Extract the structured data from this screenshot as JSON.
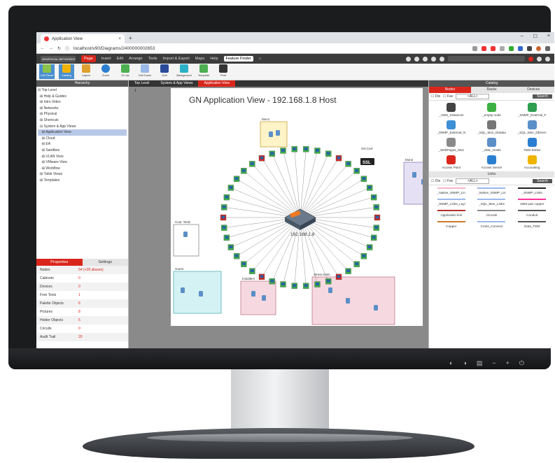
{
  "browser": {
    "tab_title": "Application View",
    "tab_close": "×",
    "new_tab": "+",
    "url": "localhost/v90/Diagrams/2400000002653",
    "win_min": "–",
    "win_max": "☐",
    "win_close": "×"
  },
  "app": {
    "logo_text": "GRAPHICAL NETWORKS",
    "menu": [
      "Page",
      "Insert",
      "Edit",
      "Arrange",
      "Tools",
      "Import & Export",
      "Maps",
      "Help"
    ],
    "feature_finder": "Feature Finder",
    "ribbon": [
      "Left Panel",
      "Catalog",
      "Layers",
      "Zoom",
      "Go Up",
      "Drill Down",
      "Grid",
      "Background",
      "Template",
      "Print"
    ]
  },
  "hierarchy": {
    "header": "Hierarchy",
    "items": [
      "Top Level",
      "Help & Guides",
      "Intro Video",
      "Networks",
      "Physical",
      "Shortcuts",
      "System & App Views",
      "Application View",
      "Cloud",
      "EA",
      "Sandbox",
      "VLAN View",
      "VMware View",
      "Workflow",
      "Table Views",
      "Templates"
    ]
  },
  "properties": {
    "tabs": [
      "Properties",
      "Settings"
    ],
    "rows": [
      {
        "label": "Nodes",
        "value": "54 (+28 aliases)"
      },
      {
        "label": "Cabinets",
        "value": "0"
      },
      {
        "label": "Devices",
        "value": "0"
      },
      {
        "label": "Free Texts",
        "value": "1"
      },
      {
        "label": "Palette Objects",
        "value": "6"
      },
      {
        "label": "Pictures",
        "value": "8"
      },
      {
        "label": "Holder Objects",
        "value": "5"
      },
      {
        "label": "Circuits",
        "value": "0"
      },
      {
        "label": "Audit Trail",
        "value": "20"
      }
    ]
  },
  "breadcrumbs": [
    "Top Level",
    "System & App Views",
    "Application View"
  ],
  "diagram": {
    "page_number": "1",
    "title": "GN Application View - 192.168.1.8 Host",
    "host_label": "192.168.1.8",
    "groups": [
      {
        "label": "Mon1"
      },
      {
        "label": "GN Cert"
      },
      {
        "label": "Mon2"
      },
      {
        "label": "Cust. Tests"
      },
      {
        "label": "Guest"
      },
      {
        "label": "Installers"
      },
      {
        "label": "Stress tests"
      }
    ],
    "ssl_label": "SSL"
  },
  "catalog": {
    "header": "Catalog",
    "tabs": [
      "Nodes",
      "Racks",
      "Devices"
    ],
    "filter_dis": "Dis",
    "filter_fav": "Fav",
    "filter_all": "<ALL>",
    "search": "Search",
    "nodes": [
      {
        "label": "_AWS_Instances",
        "color": "#444"
      },
      {
        "label": "_empty node",
        "color": "#3cb043"
      },
      {
        "label": "_SNMP_External_F",
        "color": "#2e9e4f"
      },
      {
        "label": "_SNMP_External_N",
        "color": "#3d8fd6"
      },
      {
        "label": "_SQL_Mon_Databa",
        "color": "#777"
      },
      {
        "label": "_SQL_Mon_DbServ",
        "color": "#5b8fc7"
      },
      {
        "label": "_WebPages_Mon",
        "color": "#8a8a8a"
      },
      {
        "label": "_XML_Hosts",
        "color": "#5b8fc7"
      },
      {
        "label": "7500 Series",
        "color": "#2b7fd0"
      },
      {
        "label": "Access Point",
        "color": "#d9261c"
      },
      {
        "label": "Access Server",
        "color": "#2b7fd0"
      },
      {
        "label": "Accounting",
        "color": "#f0b400"
      }
    ],
    "links_header": "Links",
    "links": [
      {
        "label": "_Native_SNMP_Lin",
        "color": "#f4b6c6"
      },
      {
        "label": "_Native_SNMP_Lin",
        "color": "#9ab8e8"
      },
      {
        "label": "_SNMP_Links",
        "color": "#222222"
      },
      {
        "label": "_SNMP_Links_Layr",
        "color": "#9ab8e8"
      },
      {
        "label": "_SQL_Mon_Links",
        "color": "#9ab8e8"
      },
      {
        "label": "1550 pair copper",
        "color": "#ff3399"
      },
      {
        "label": "Application link",
        "color": "#b03030"
      },
      {
        "label": "Circuits",
        "color": "#888888"
      },
      {
        "label": "Conduit",
        "color": "#555555"
      },
      {
        "label": "Copper",
        "color": "#c97a30"
      },
      {
        "label": "Cross_Connect",
        "color": "#9ab8e8"
      },
      {
        "label": "Data_TDM",
        "color": "#555555"
      }
    ]
  },
  "monitor_controls": [
    "◐",
    "◑",
    "▤",
    "−",
    "+",
    "⏻"
  ]
}
